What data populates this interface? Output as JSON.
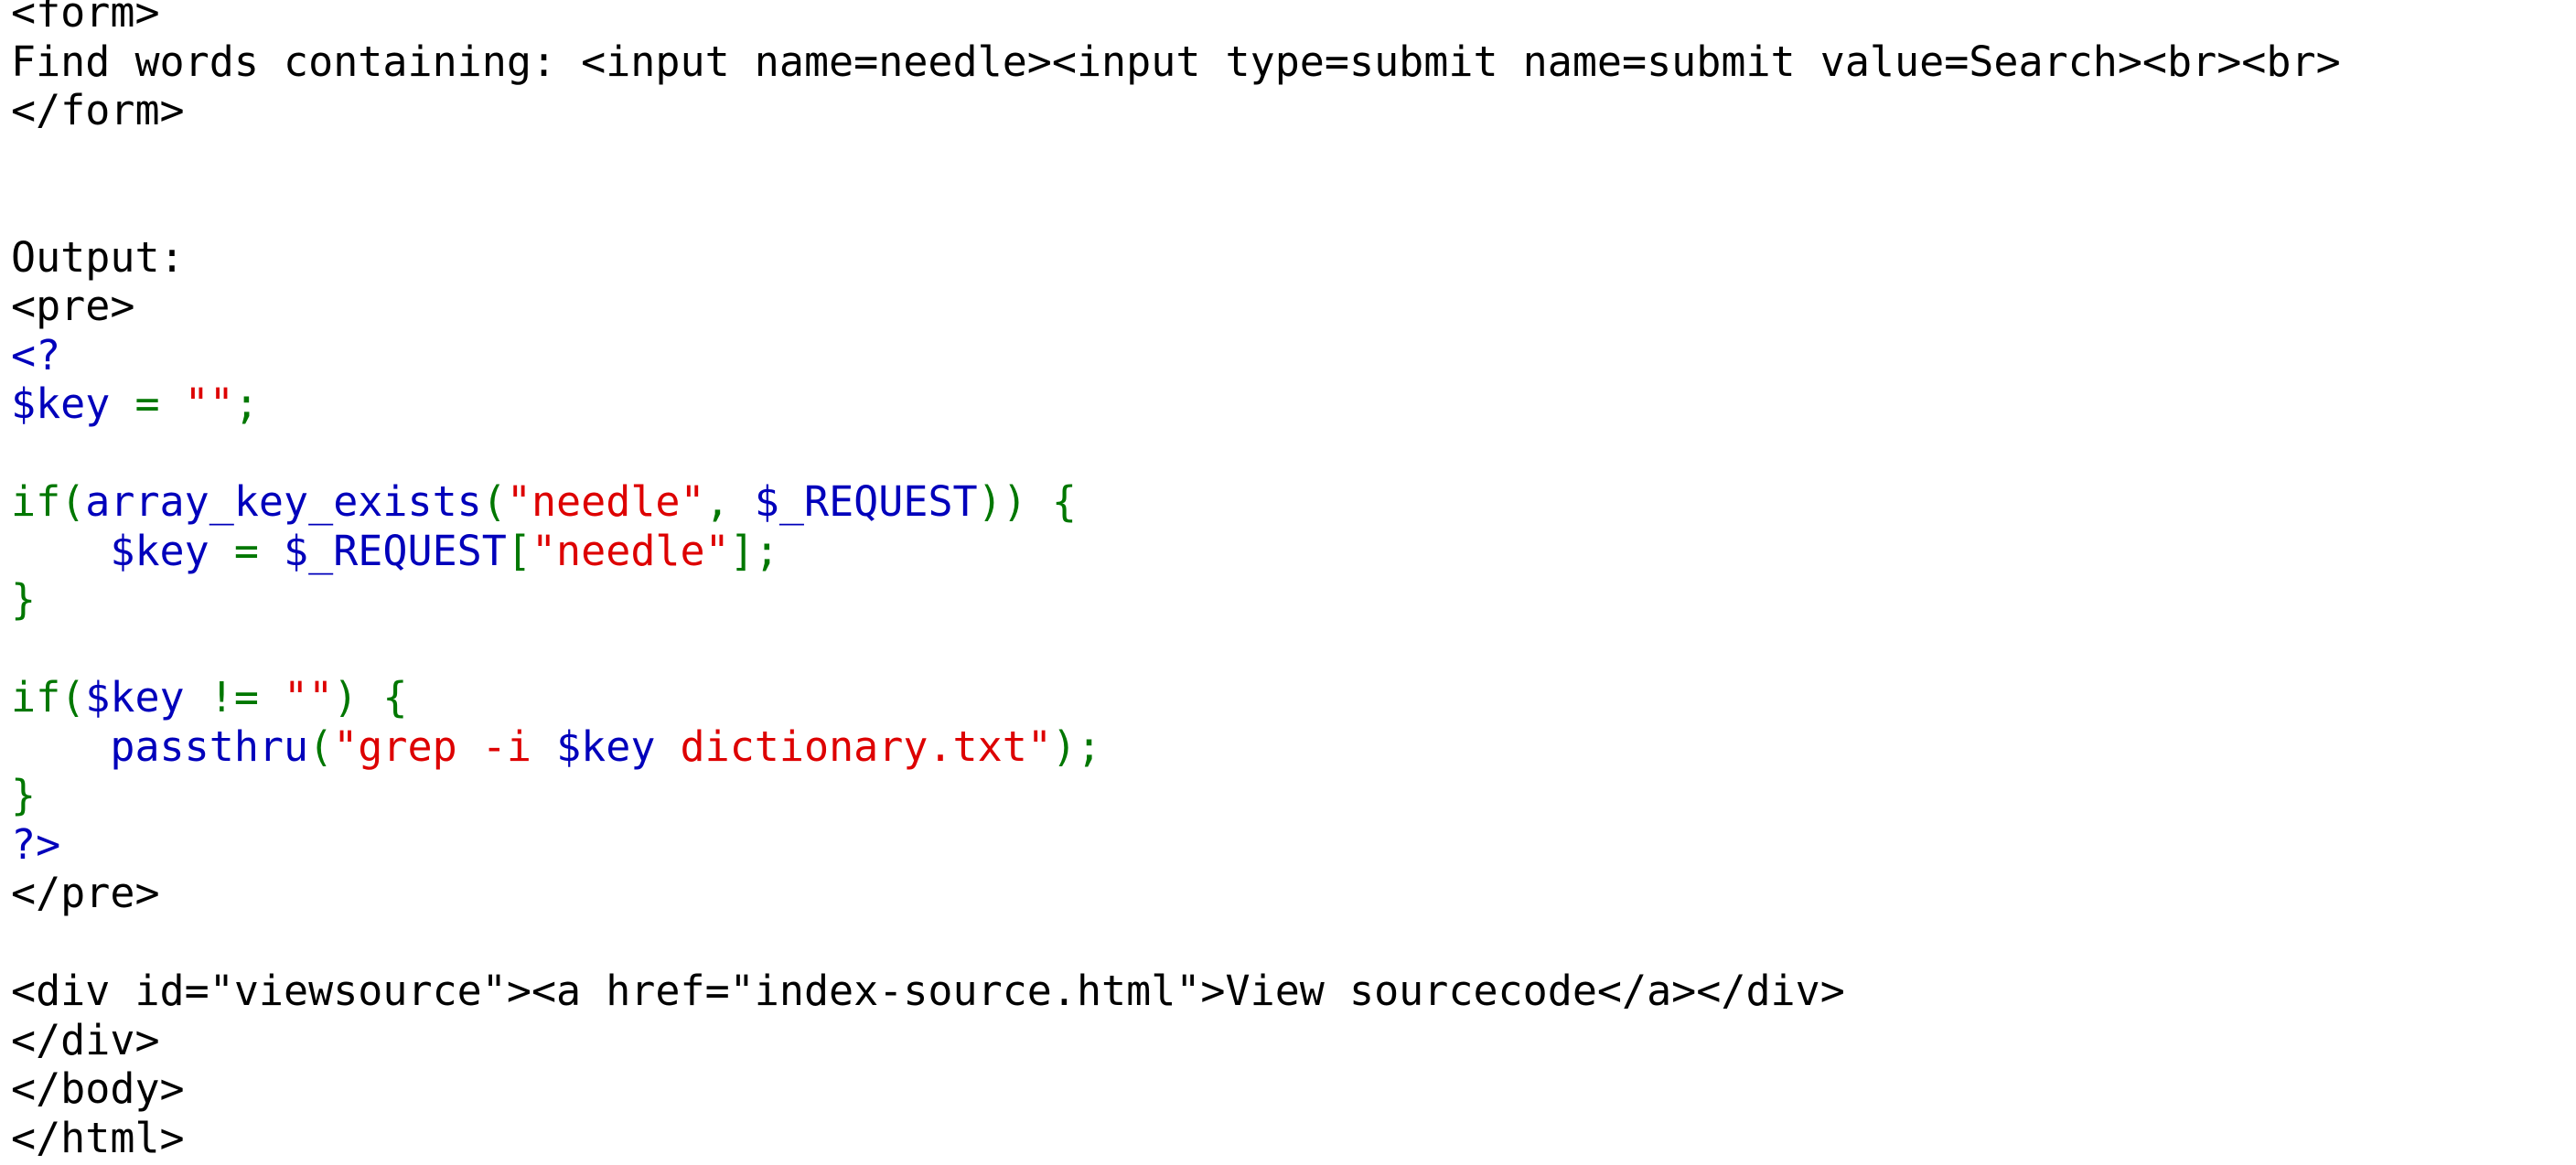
{
  "source_view": {
    "lines": [
      [
        {
          "t": "<form>",
          "c": "plain"
        }
      ],
      [
        {
          "t": "Find words containing: <input name=needle><input type=submit name=submit value=Search><br><br>",
          "c": "plain"
        }
      ],
      [
        {
          "t": "</form>",
          "c": "plain"
        }
      ],
      [],
      [],
      [
        {
          "t": "Output:",
          "c": "plain"
        }
      ],
      [
        {
          "t": "<pre>",
          "c": "plain"
        }
      ],
      [
        {
          "t": "<?",
          "c": "php"
        }
      ],
      [
        {
          "t": "$key",
          "c": "php"
        },
        {
          "t": " = ",
          "c": "kw"
        },
        {
          "t": "\"\"",
          "c": "str"
        },
        {
          "t": ";",
          "c": "kw"
        }
      ],
      [],
      [
        {
          "t": "if(",
          "c": "kw"
        },
        {
          "t": "array_key_exists",
          "c": "php"
        },
        {
          "t": "(",
          "c": "kw"
        },
        {
          "t": "\"needle\"",
          "c": "str"
        },
        {
          "t": ", ",
          "c": "kw"
        },
        {
          "t": "$_REQUEST",
          "c": "php"
        },
        {
          "t": ")) {",
          "c": "kw"
        }
      ],
      [
        {
          "t": "    ",
          "c": "plain"
        },
        {
          "t": "$key",
          "c": "php"
        },
        {
          "t": " = ",
          "c": "kw"
        },
        {
          "t": "$_REQUEST",
          "c": "php"
        },
        {
          "t": "[",
          "c": "kw"
        },
        {
          "t": "\"needle\"",
          "c": "str"
        },
        {
          "t": "];",
          "c": "kw"
        }
      ],
      [
        {
          "t": "}",
          "c": "kw"
        }
      ],
      [],
      [
        {
          "t": "if(",
          "c": "kw"
        },
        {
          "t": "$key",
          "c": "php"
        },
        {
          "t": " != ",
          "c": "kw"
        },
        {
          "t": "\"\"",
          "c": "str"
        },
        {
          "t": ") {",
          "c": "kw"
        }
      ],
      [
        {
          "t": "    ",
          "c": "plain"
        },
        {
          "t": "passthru",
          "c": "php"
        },
        {
          "t": "(",
          "c": "kw"
        },
        {
          "t": "\"grep -i ",
          "c": "str"
        },
        {
          "t": "$key",
          "c": "php"
        },
        {
          "t": " dictionary.txt\"",
          "c": "str"
        },
        {
          "t": ");",
          "c": "kw"
        }
      ],
      [
        {
          "t": "}",
          "c": "kw"
        }
      ],
      [
        {
          "t": "?>",
          "c": "php"
        }
      ],
      [
        {
          "t": "</pre>",
          "c": "plain"
        }
      ],
      [],
      [
        {
          "t": "<div id=\"viewsource\"><a href=\"index-source.html\">View sourcecode</a></div>",
          "c": "plain"
        }
      ],
      [
        {
          "t": "</div>",
          "c": "plain"
        }
      ],
      [
        {
          "t": "</body>",
          "c": "plain"
        }
      ],
      [
        {
          "t": "</html>",
          "c": "plain"
        }
      ]
    ]
  },
  "colors": {
    "plain": "#000000",
    "php": "#0000bb",
    "keyword": "#007700",
    "string": "#dd0000"
  }
}
